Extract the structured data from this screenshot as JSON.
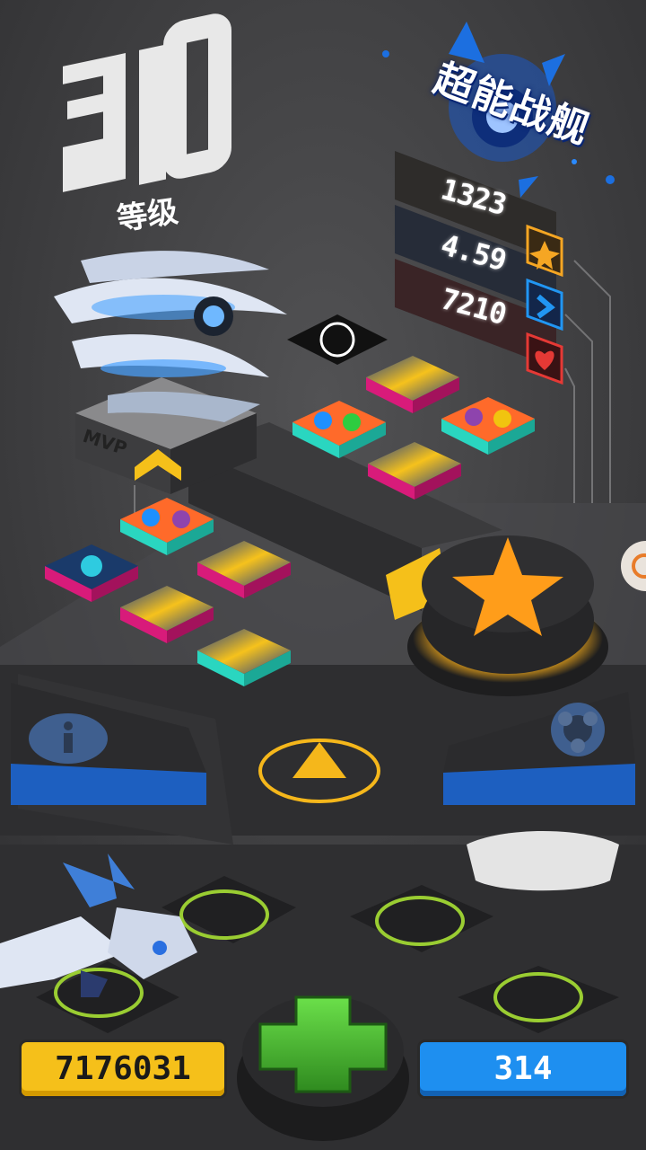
{
  "level": {
    "number": "310",
    "label": "等级"
  },
  "ship": {
    "title": "超能战舰",
    "stats": [
      {
        "value": "1323",
        "icon": "star-icon",
        "color": "#f5a623"
      },
      {
        "value": "4.59",
        "icon": "speed-arrow-icon",
        "color": "#2196f3"
      },
      {
        "value": "7210",
        "icon": "heart-icon",
        "color": "#e53935"
      }
    ],
    "badge": "MVP"
  },
  "currency": {
    "coins": "7176031",
    "gems": "314"
  },
  "colors": {
    "gold": "#f5c01a",
    "blue": "#1e8ff0",
    "accent_orange": "#ff9d1a",
    "slot_green": "#9acd32"
  }
}
